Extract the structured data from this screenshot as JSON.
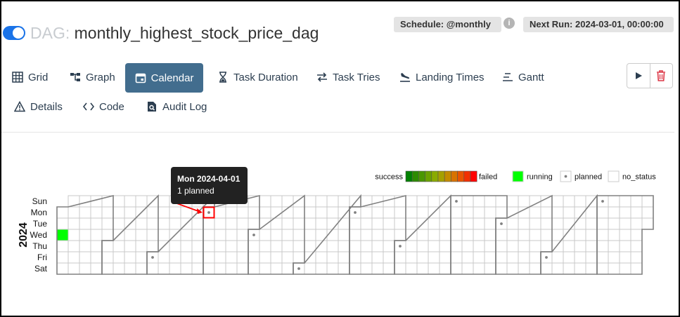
{
  "header": {
    "dag_prefix": "DAG:",
    "dag_name": "monthly_highest_stock_price_dag",
    "schedule": "Schedule: @monthly",
    "info_glyph": "i",
    "next_run": "Next Run: 2024-03-01, 00:00:00",
    "paused": false
  },
  "tabs": [
    {
      "label": "Grid",
      "icon": "grid-icon",
      "active": false
    },
    {
      "label": "Graph",
      "icon": "graph-icon",
      "active": false
    },
    {
      "label": "Calendar",
      "icon": "calendar-icon",
      "active": true
    },
    {
      "label": "Task Duration",
      "icon": "hourglass-icon",
      "active": false
    },
    {
      "label": "Task Tries",
      "icon": "retry-arrows-icon",
      "active": false
    },
    {
      "label": "Landing Times",
      "icon": "plane-landing-icon",
      "active": false
    },
    {
      "label": "Gantt",
      "icon": "gantt-icon",
      "active": false
    },
    {
      "label": "Details",
      "icon": "warning-triangle-icon",
      "active": false
    },
    {
      "label": "Code",
      "icon": "code-brackets-icon",
      "active": false
    },
    {
      "label": "Audit Log",
      "icon": "search-document-icon",
      "active": false
    }
  ],
  "actions": [
    {
      "name": "trigger",
      "icon": "play-icon"
    },
    {
      "name": "delete",
      "icon": "trash-icon"
    }
  ],
  "colors": {
    "accent": "#426d8e",
    "toggle": "#1a73e8",
    "running": "#00ff00",
    "planned_dot": "#808080",
    "cell_border": "#c8c8c8",
    "month_border": "#808080",
    "tooltip_highlight": "#ff0000",
    "scale": [
      "#008000",
      "#2e8b00",
      "#4a9600",
      "#6ba100",
      "#8aab00",
      "#a5a000",
      "#c38b00",
      "#d87300",
      "#e85500",
      "#f23000",
      "#ff0000"
    ]
  },
  "calendar": {
    "year_label": "2024",
    "days": [
      "Sun",
      "Mon",
      "Tue",
      "Wed",
      "Thu",
      "Fri",
      "Sat"
    ],
    "legend": {
      "success": "success",
      "failed": "failed",
      "running": "running",
      "planned": "planned",
      "no_status": "no_status"
    },
    "runs": [
      {
        "date": "2024-01-03",
        "state": "running"
      },
      {
        "date": "2024-03-01",
        "state": "planned"
      },
      {
        "date": "2024-04-01",
        "state": "planned"
      },
      {
        "date": "2024-05-01",
        "state": "planned"
      },
      {
        "date": "2024-06-01",
        "state": "planned"
      },
      {
        "date": "2024-07-01",
        "state": "planned"
      },
      {
        "date": "2024-08-01",
        "state": "planned"
      },
      {
        "date": "2024-09-01",
        "state": "planned"
      },
      {
        "date": "2024-10-01",
        "state": "planned"
      },
      {
        "date": "2024-11-01",
        "state": "planned"
      },
      {
        "date": "2024-12-01",
        "state": "planned"
      }
    ],
    "highlight_date": "2024-04-01",
    "tooltip": {
      "title": "Mon 2024-04-01",
      "body": "1 planned"
    }
  }
}
